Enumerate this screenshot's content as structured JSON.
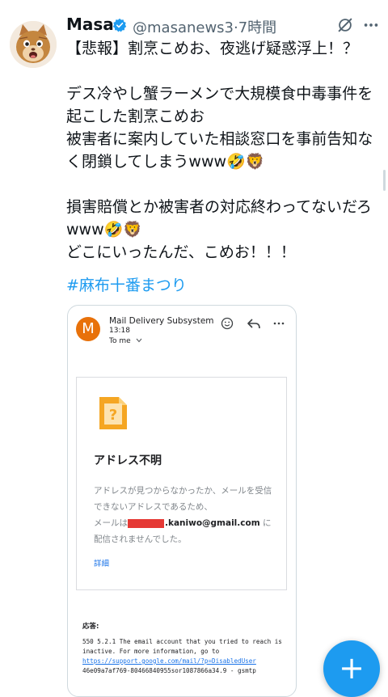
{
  "tweet": {
    "author_name": "Masa",
    "handle_time": "@masanews3·7時間",
    "body": "【悲報】割烹こめお、夜逃げ疑惑浮上！？\n\nデス冷やし蟹ラーメンで大規模食中毒事件を起こした割烹こめお\n被害者に案内していた相談窓口を事前告知なく閉鎖してしまうwww🤣🦁\n\n損害賠償とか被害者の対応終わってないだろwww🤣🦁\nどこにいったんだ、こめお！！！",
    "hashtag": "#麻布十番まつり"
  },
  "email": {
    "avatar_letter": "M",
    "sender": "Mail Delivery Subsystem",
    "time": "13:18",
    "to": "To me",
    "card_title": "アドレス不明",
    "card_body_pre": "アドレスが見つからなかったか、メールを受信できないアドレスであるため、\nメールは",
    "card_email": ".kaniwo@gmail.com",
    "card_body_post": " に\n配信されませんでした。",
    "details_link": "詳細",
    "response_label": "応答:",
    "response_line1": "550 5.2.1 The email account that you tried to reach is inactive. For more information, go to ",
    "response_link": "https://support.google.com/mail/?p=DisabledUser",
    "response_line2": " 46e09a7af769-80466840955sor1087866a34.9 - gsmtp"
  },
  "fab": {
    "label": "+"
  },
  "colors": {
    "accent": "#1d9bf0",
    "link": "#1a73e8",
    "redaction": "#e53935",
    "gmail_avatar": "#e8710a"
  },
  "icons": [
    "verified-badge-icon",
    "grok-icon",
    "more-icon",
    "emoji-reaction-icon",
    "reply-icon",
    "email-more-icon",
    "question-file-icon",
    "chevron-down-icon",
    "plus-icon"
  ]
}
